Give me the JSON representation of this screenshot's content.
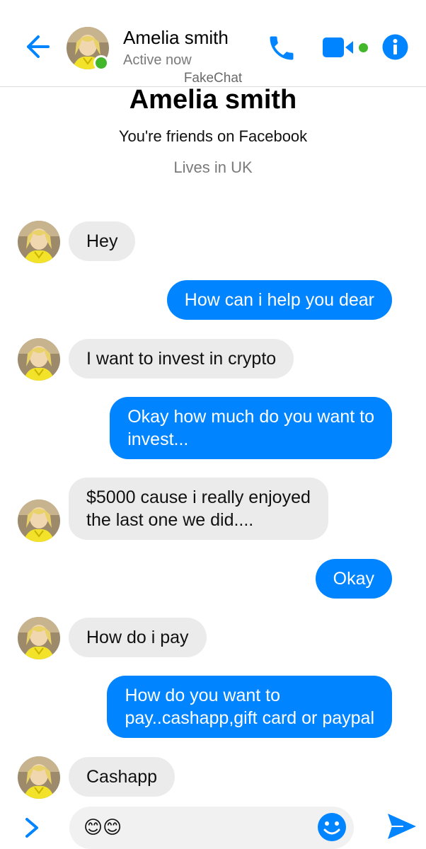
{
  "header": {
    "name": "Amelia smith",
    "status": "Active now",
    "watermark": "FakeChat",
    "icons": [
      "back-arrow-icon",
      "phone-icon",
      "video-camera-icon",
      "info-icon"
    ]
  },
  "profile": {
    "name": "Amelia smith",
    "friends": "You're friends on Facebook",
    "lives": "Lives in UK"
  },
  "messages": [
    {
      "from": "them",
      "text": "Hey"
    },
    {
      "from": "me",
      "text": "How can i help you dear"
    },
    {
      "from": "them",
      "text": "I want to invest in crypto"
    },
    {
      "from": "me",
      "line1": "Okay how much do you want to",
      "line2": "invest..."
    },
    {
      "from": "them",
      "line1": "$5000 cause i really enjoyed",
      "line2": "the last one we did...."
    },
    {
      "from": "me",
      "text": "Okay"
    },
    {
      "from": "them",
      "text": "How do i pay"
    },
    {
      "from": "me",
      "line1": "How do you want to",
      "line2": "pay..cashapp,gift card or paypal"
    },
    {
      "from": "them",
      "text": "Cashapp"
    }
  ],
  "composer": {
    "input_value": "😊😊"
  },
  "colors": {
    "accent": "#0084ff",
    "incoming_bubble": "#ebebeb",
    "online": "#42b72a"
  }
}
